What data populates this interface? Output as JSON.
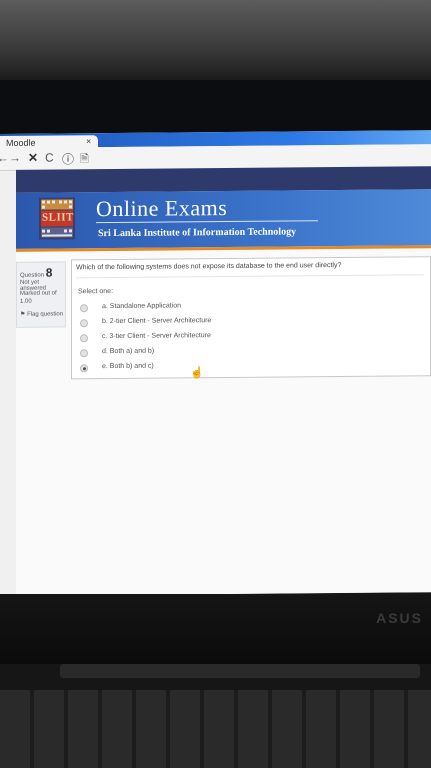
{
  "browser": {
    "tab_title": "Moodle",
    "tab_close": "×",
    "back_glyph": "←",
    "forward_glyph": "→",
    "stop_glyph": "✕",
    "reload_glyph": "C",
    "info_glyph": "ⓘ",
    "page_glyph": "🗎"
  },
  "header": {
    "logo_text": "SLIIT",
    "title": "Online Exams",
    "subtitle": "Sri Lanka Institute of Information Technology"
  },
  "question_info": {
    "label": "Question",
    "number": "8",
    "status": "Not yet answered",
    "marked_out_of": "Marked out of",
    "mark_value": "1.00",
    "flag_label": "Flag question"
  },
  "question": {
    "text": "Which of the following systems does not expose its database to the end user directly?",
    "select_label": "Select one:",
    "options": [
      {
        "label": "a. Standalone Application",
        "checked": false
      },
      {
        "label": "b. 2-tier Client - Server Architecture",
        "checked": false
      },
      {
        "label": "c. 3-tier Client - Server Architecture",
        "checked": false
      },
      {
        "label": "d. Both a) and b)",
        "checked": false
      },
      {
        "label": "e. Both b) and c)",
        "checked": true
      }
    ]
  },
  "screen_brand": "ASUS",
  "colors": {
    "header_blue": "#2b58ad",
    "accent_orange": "#e08a2b",
    "nav_dark": "#2d3a6b"
  }
}
